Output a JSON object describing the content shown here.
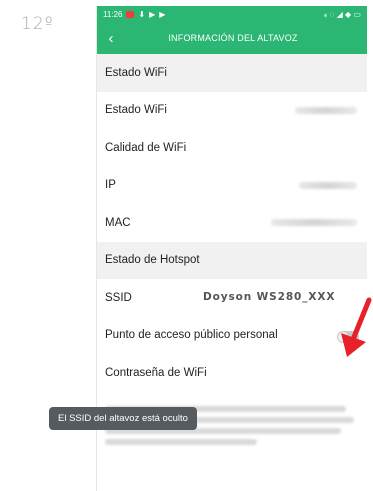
{
  "step_label": "12º",
  "status_bar": {
    "time": "11:26",
    "right_icons": "⁎ ◌ ◢ ◆ ▭"
  },
  "header": {
    "back_icon": "chevron-left-icon",
    "title": "INFORMACIÓN DEL ALTAVOZ"
  },
  "rows": [
    {
      "label": "Estado WiFi"
    },
    {
      "label": "Estado WiFi"
    },
    {
      "label": "Calidad de WiFi"
    },
    {
      "label": "IP"
    },
    {
      "label": "MAC"
    },
    {
      "label": "Estado de Hotspot"
    },
    {
      "label": "SSID",
      "value": "Doyson WS280_XXX"
    },
    {
      "label": "Punto de acceso público personal",
      "toggle_on": false
    },
    {
      "label": "Contraseña de WiFi"
    }
  ],
  "toast": "El SSID del altavoz está oculto",
  "colors": {
    "accent": "#2bb673",
    "arrow": "#e8202a",
    "toast_bg": "#555b5e"
  }
}
